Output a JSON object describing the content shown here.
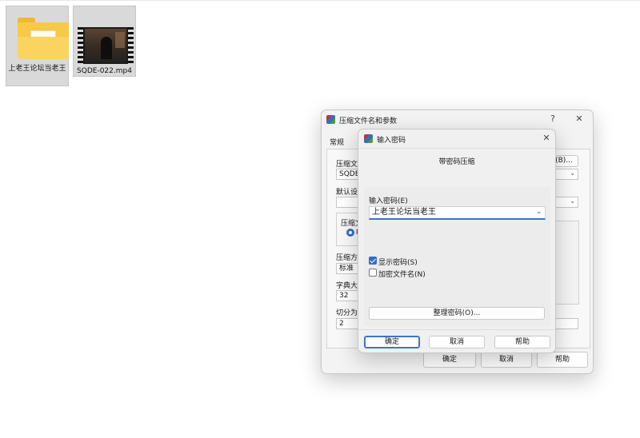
{
  "desktop": {
    "files": [
      {
        "name": "上老王论坛当老王",
        "type": "folder"
      },
      {
        "name": "SQDE-022.mp4",
        "type": "video"
      }
    ]
  },
  "main_dialog": {
    "title": "压缩文件名和参数",
    "help_glyph": "?",
    "close_glyph": "✕",
    "tab_general": "常规",
    "archive_name_label": "压缩文",
    "archive_name_value": "SQDE-0",
    "browse_button": "(B)...",
    "default_profile_label": "默认设",
    "format_label": "压缩文",
    "format_radio": "R",
    "method_label": "压缩方",
    "method_value": "标准",
    "dict_label": "字典大",
    "dict_value": "32",
    "split_label": "切分为",
    "split_value": "2",
    "ok": "确定",
    "cancel": "取消",
    "help": "帮助"
  },
  "password_dialog": {
    "title": "输入密码",
    "close_glyph": "✕",
    "heading": "带密码压缩",
    "password_label": "输入密码(E)",
    "password_value": "上老王论坛当老王",
    "show_password": {
      "label": "显示密码(S)",
      "checked": true
    },
    "encrypt_names": {
      "label": "加密文件名(N)",
      "checked": false
    },
    "organize_button": "整理密码(O)...",
    "ok": "确定",
    "cancel": "取消",
    "help": "帮助"
  },
  "colors": {
    "accent": "#3d74c7",
    "folder": "#f7c948",
    "dialog_bg": "#f3f3f3"
  }
}
